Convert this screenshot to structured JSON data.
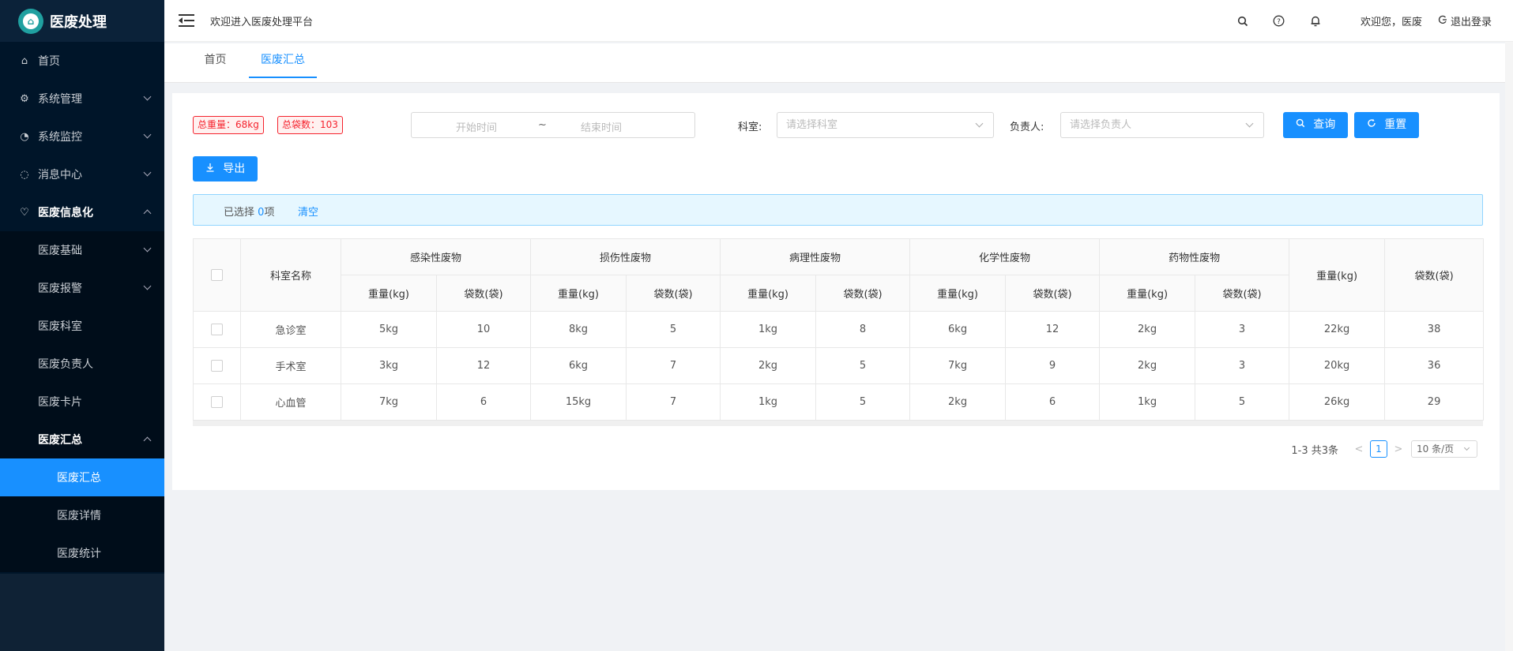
{
  "app": {
    "logo_title": "医废处理",
    "logo_mark": "⌂"
  },
  "header": {
    "platform_text": "欢迎进入医废处理平台",
    "greeting": "欢迎您，医废",
    "logout_label": "退出登录"
  },
  "sidebar": {
    "items": [
      {
        "label": "首页",
        "icon": "⌂"
      },
      {
        "label": "系统管理",
        "icon": "⚙"
      },
      {
        "label": "系统监控",
        "icon": "◔"
      },
      {
        "label": "消息中心",
        "icon": "◌"
      },
      {
        "label": "医废信息化",
        "icon": "♡"
      }
    ],
    "sub_items": [
      {
        "label": "医废基础"
      },
      {
        "label": "医废报警"
      },
      {
        "label": "医废科室"
      },
      {
        "label": "医废负责人"
      },
      {
        "label": "医废卡片"
      },
      {
        "label": "医废汇总"
      }
    ],
    "sub2_items": [
      {
        "label": "医废汇总"
      },
      {
        "label": "医废详情"
      },
      {
        "label": "医废统计"
      }
    ]
  },
  "tabs": [
    {
      "label": "首页"
    },
    {
      "label": "医废汇总"
    }
  ],
  "filters": {
    "total_weight": "总重量：68kg",
    "total_bags": "总袋数：103",
    "start_placeholder": "开始时间",
    "range_sep": "~",
    "end_placeholder": "结束时间",
    "dept_label": "科室:",
    "dept_placeholder": "请选择科室",
    "owner_label": "负责人:",
    "owner_placeholder": "请选择负责人",
    "query_label": "查询",
    "reset_label": "重置",
    "export_label": "导出"
  },
  "selection": {
    "prefix": "已选择",
    "count": "0",
    "suffix": "项",
    "clear_label": "清空"
  },
  "table": {
    "dept_header": "科室名称",
    "groups": [
      "感染性废物",
      "损伤性废物",
      "病理性废物",
      "化学性废物",
      "药物性废物"
    ],
    "weight_header": "重量(kg)",
    "bags_header": "袋数(袋)",
    "total_weight_header": "重量(kg)",
    "total_bags_header": "袋数(袋)",
    "rows": [
      {
        "dept": "急诊室",
        "cells": [
          "5kg",
          "10",
          "8kg",
          "5",
          "1kg",
          "8",
          "6kg",
          "12",
          "2kg",
          "3"
        ],
        "total_weight": "22kg",
        "total_bags": "38"
      },
      {
        "dept": "手术室",
        "cells": [
          "3kg",
          "12",
          "6kg",
          "7",
          "2kg",
          "5",
          "7kg",
          "9",
          "2kg",
          "3"
        ],
        "total_weight": "20kg",
        "total_bags": "36"
      },
      {
        "dept": "心血管",
        "cells": [
          "7kg",
          "6",
          "15kg",
          "7",
          "1kg",
          "5",
          "2kg",
          "6",
          "1kg",
          "5"
        ],
        "total_weight": "26kg",
        "total_bags": "29"
      }
    ]
  },
  "pagination": {
    "total_text": "1-3 共3条",
    "current_page": "1",
    "page_size": "10 条/页",
    "prev": "<",
    "next": ">"
  },
  "colors": {
    "primary": "#1890ff",
    "sidebar_bg": "#001529",
    "danger": "#f5222d"
  }
}
